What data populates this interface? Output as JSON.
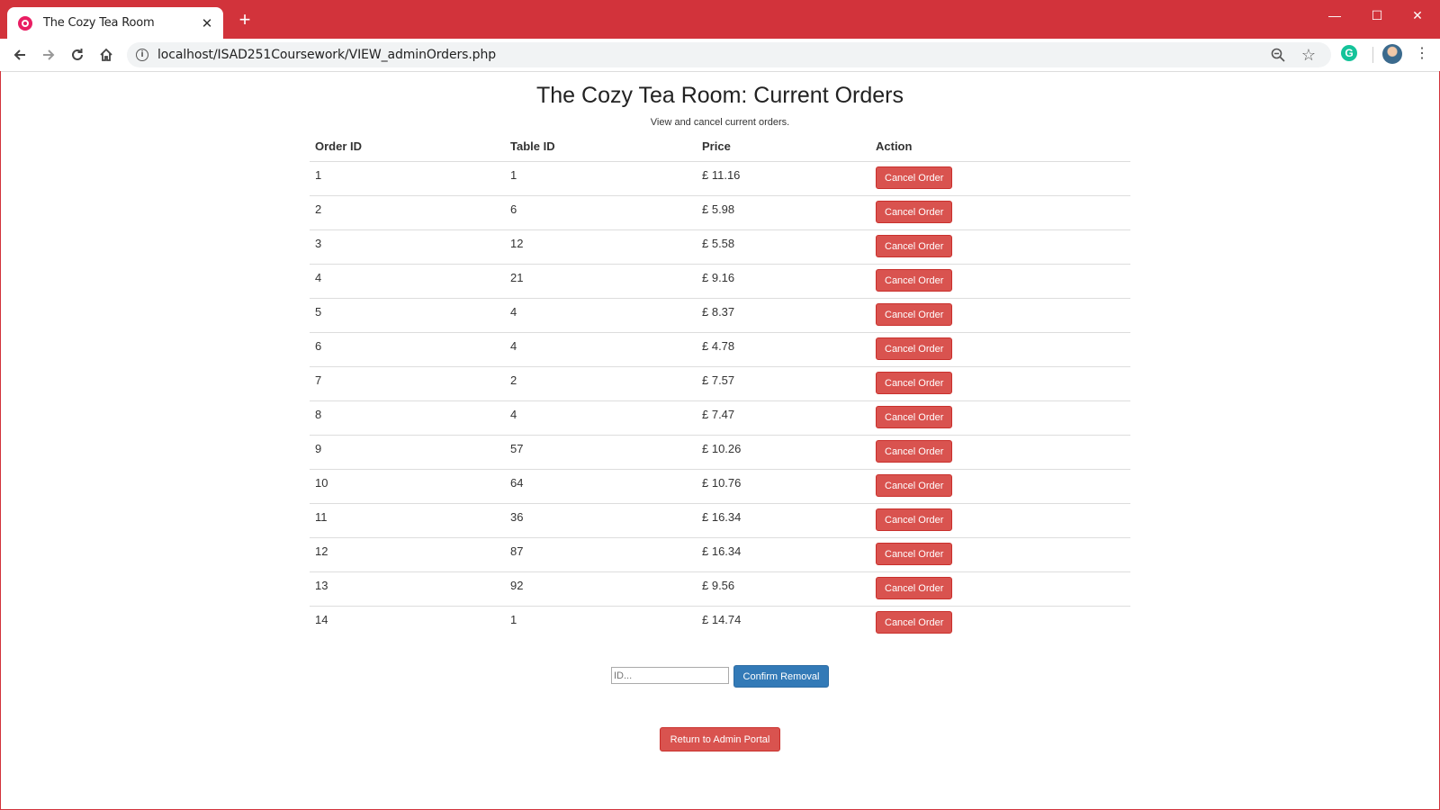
{
  "browser": {
    "tab_title": "The Cozy Tea Room",
    "tab_close": "✕",
    "new_tab": "+",
    "url": "localhost/ISAD251Coursework/VIEW_adminOrders.php",
    "window_min": "—",
    "window_max": "☐",
    "window_close": "✕",
    "extension_letter": "G",
    "accent_color": "#d2333b"
  },
  "page": {
    "title": "The Cozy Tea Room: Current Orders",
    "subtitle": "View and cancel current orders."
  },
  "table": {
    "headers": [
      "Order ID",
      "Table ID",
      "Price",
      "Action"
    ],
    "rows": [
      {
        "order_id": "1",
        "table_id": "1",
        "price": "£ 11.16",
        "action": "Cancel Order"
      },
      {
        "order_id": "2",
        "table_id": "6",
        "price": "£ 5.98",
        "action": "Cancel Order"
      },
      {
        "order_id": "3",
        "table_id": "12",
        "price": "£ 5.58",
        "action": "Cancel Order"
      },
      {
        "order_id": "4",
        "table_id": "21",
        "price": "£ 9.16",
        "action": "Cancel Order"
      },
      {
        "order_id": "5",
        "table_id": "4",
        "price": "£ 8.37",
        "action": "Cancel Order"
      },
      {
        "order_id": "6",
        "table_id": "4",
        "price": "£ 4.78",
        "action": "Cancel Order"
      },
      {
        "order_id": "7",
        "table_id": "2",
        "price": "£ 7.57",
        "action": "Cancel Order"
      },
      {
        "order_id": "8",
        "table_id": "4",
        "price": "£ 7.47",
        "action": "Cancel Order"
      },
      {
        "order_id": "9",
        "table_id": "57",
        "price": "£ 10.26",
        "action": "Cancel Order"
      },
      {
        "order_id": "10",
        "table_id": "64",
        "price": "£ 10.76",
        "action": "Cancel Order"
      },
      {
        "order_id": "11",
        "table_id": "36",
        "price": "£ 16.34",
        "action": "Cancel Order"
      },
      {
        "order_id": "12",
        "table_id": "87",
        "price": "£ 16.34",
        "action": "Cancel Order"
      },
      {
        "order_id": "13",
        "table_id": "92",
        "price": "£ 9.56",
        "action": "Cancel Order"
      },
      {
        "order_id": "14",
        "table_id": "1",
        "price": "£ 14.74",
        "action": "Cancel Order"
      }
    ]
  },
  "removal_form": {
    "id_placeholder": "ID...",
    "id_value": "",
    "confirm_label": "Confirm Removal"
  },
  "footer": {
    "return_label": "Return to Admin Portal"
  },
  "colors": {
    "danger": "#d9534f",
    "primary": "#337ab7"
  }
}
